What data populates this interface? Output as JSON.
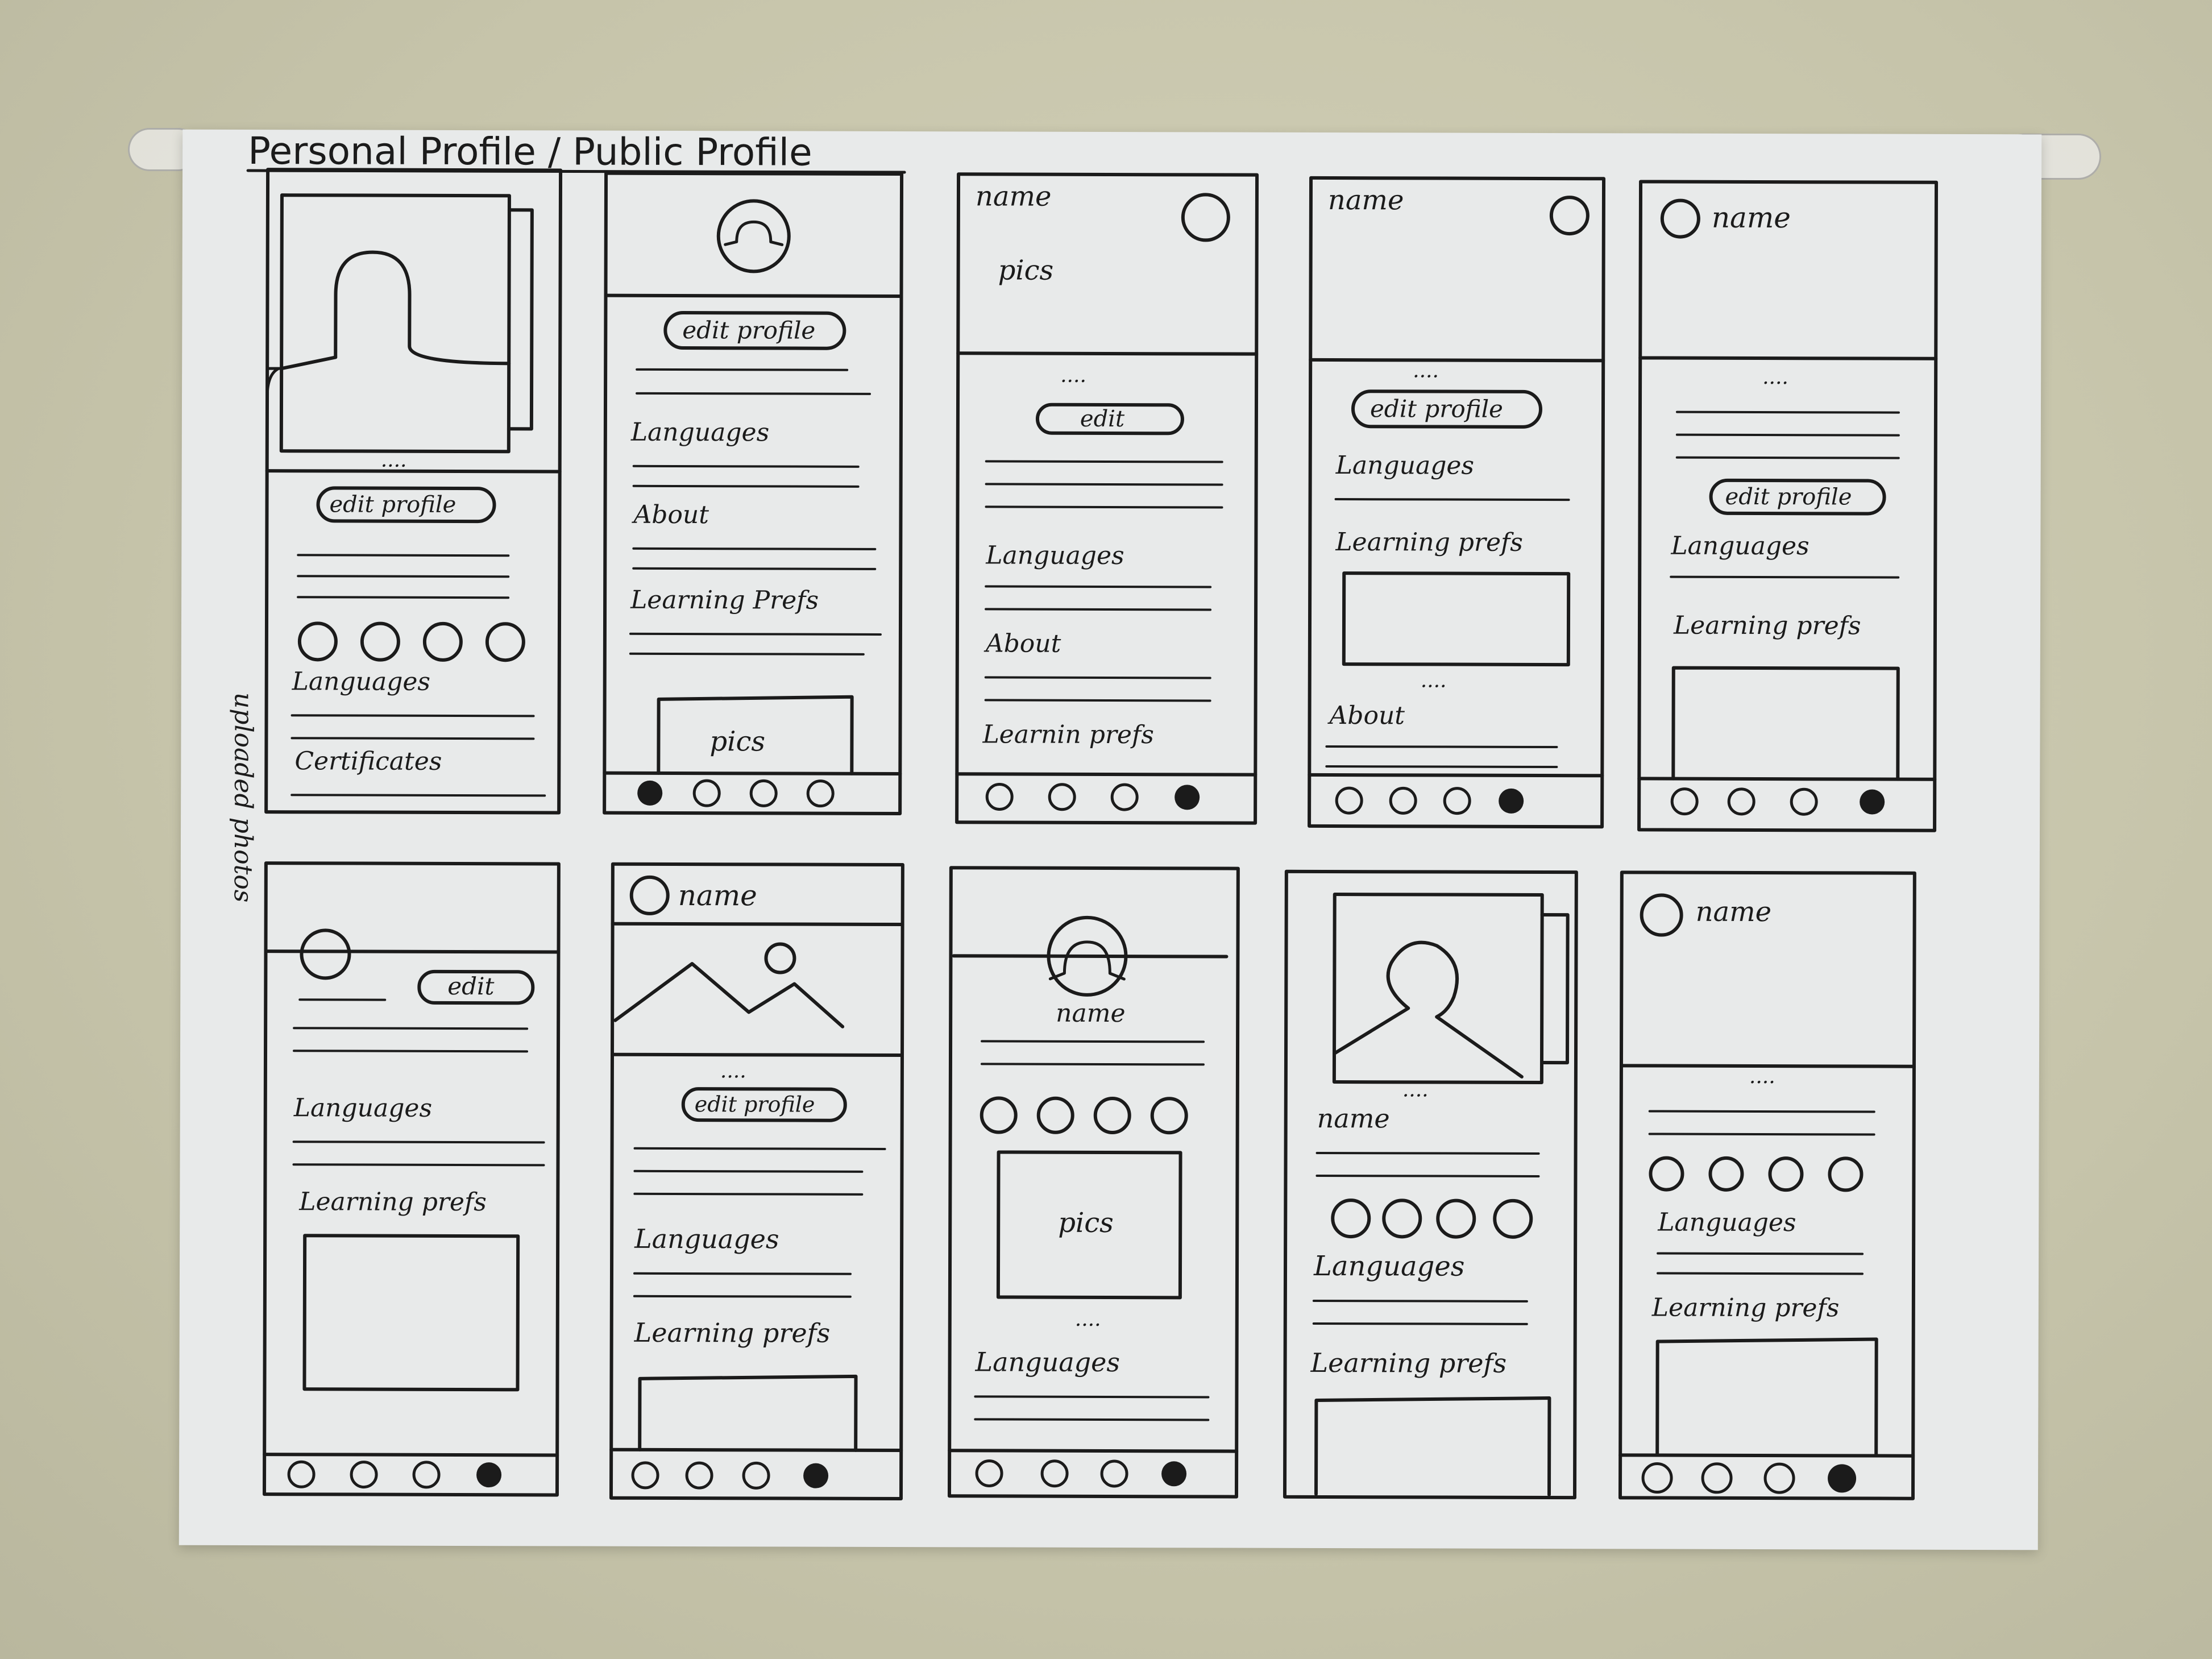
{
  "sheet": {
    "title": "Personal Profile / Public Profile",
    "side_note": "uploaded photos"
  },
  "labels": {
    "name": "name",
    "pics": "pics",
    "edit_profile": "edit profile",
    "edit": "edit",
    "languages": "Languages",
    "about": "About",
    "learning_prefs_a": "Learning Prefs",
    "learning_prefs_b": "Learning prefs",
    "learnin_prefs": "Learnin prefs",
    "certificates": "Certificates"
  },
  "colors": {
    "wall": "#c9c7ae",
    "paper": "#e8eaea",
    "ink": "#1b1b1b"
  },
  "icons": [
    "pushpin-icon",
    "profile-avatar-icon",
    "mountain-image-icon",
    "nav-dot-icon",
    "filled-nav-dot-icon"
  ]
}
